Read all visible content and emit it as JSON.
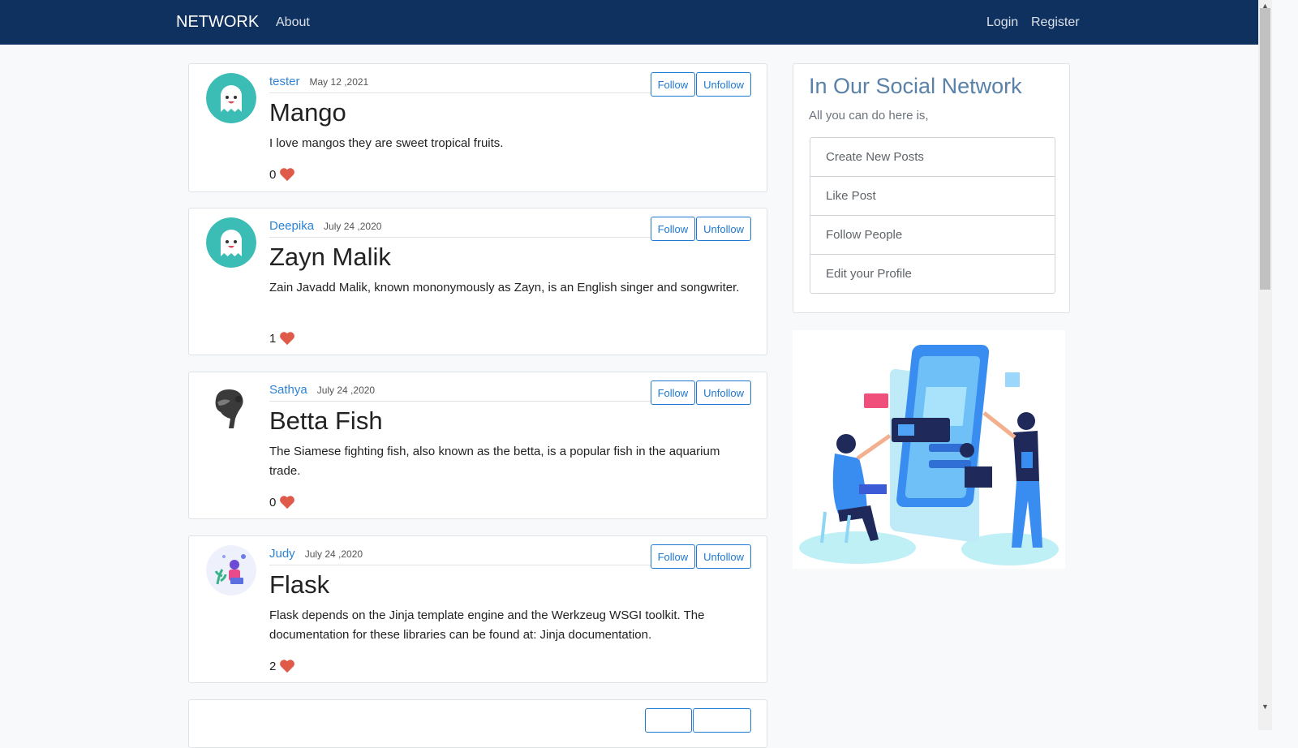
{
  "nav": {
    "brand": "NETWORK",
    "about": "About",
    "login": "Login",
    "register": "Register"
  },
  "buttons": {
    "follow": "Follow",
    "unfollow": "Unfollow"
  },
  "posts": [
    {
      "user": "tester",
      "date": "May 12 ,2021",
      "title": "Mango",
      "body": "I love mangos they are sweet tropical fruits.",
      "likes": "0",
      "avatar": "ghost-avatar"
    },
    {
      "user": "Deepika",
      "date": "July 24 ,2020",
      "title": "Zayn Malik",
      "body": "Zain Javadd Malik, known mononymously as Zayn, is an English singer and songwriter.",
      "likes": "1",
      "avatar": "ghost-avatar"
    },
    {
      "user": "Sathya",
      "date": "July 24 ,2020",
      "title": "Betta Fish",
      "body": "The Siamese fighting fish, also known as the betta, is a popular fish in the aquarium trade.",
      "likes": "0",
      "avatar": "portrait-avatar"
    },
    {
      "user": "Judy",
      "date": "July 24 ,2020",
      "title": "Flask",
      "body": "Flask depends on the Jinja template engine and the Werkzeug WSGI toolkit. The documentation for these libraries can be found at: Jinja documentation.",
      "likes": "2",
      "avatar": "illustration-avatar"
    }
  ],
  "sidebar": {
    "title": "In Our Social Network",
    "subtitle": "All you can do here is,",
    "items": [
      "Create New Posts",
      "Like Post",
      "Follow People",
      "Edit your Profile"
    ]
  },
  "colors": {
    "navbar": "#0f3160",
    "link": "#2d83d6",
    "button": "#1f78d1",
    "heart": "#e05a4a",
    "sidebar_title": "#5a82a8"
  },
  "icons": {
    "like": "heart-icon"
  }
}
